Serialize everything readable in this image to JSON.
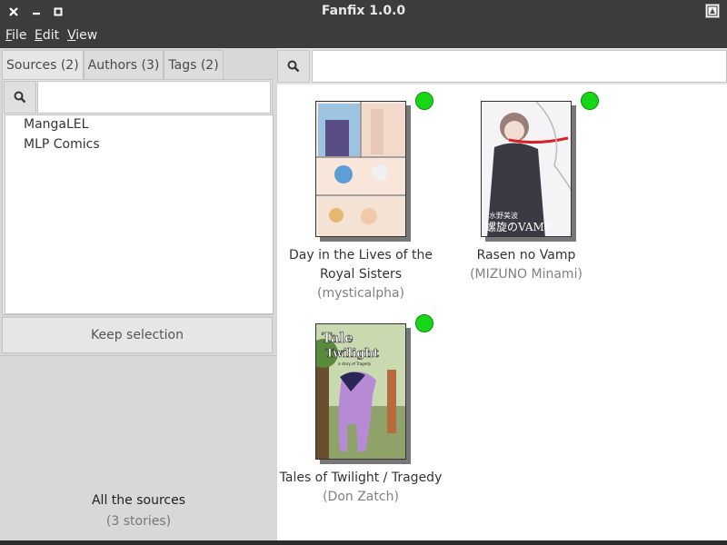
{
  "window": {
    "title": "Fanfix 1.0.0"
  },
  "menu": [
    {
      "mnemonic": "F",
      "rest": "ile"
    },
    {
      "mnemonic": "E",
      "rest": "dit"
    },
    {
      "mnemonic": "V",
      "rest": "iew"
    }
  ],
  "tabs": [
    {
      "label": "Sources (2)"
    },
    {
      "label": "Authors (3)"
    },
    {
      "label": "Tags (2)"
    }
  ],
  "sources": {
    "search_value": "",
    "items": [
      {
        "label": "MangaLEL"
      },
      {
        "label": "MLP Comics"
      }
    ],
    "keep_label": "Keep selection"
  },
  "summary": {
    "title": "All the sources",
    "count": "(3  stories)"
  },
  "library": {
    "search_value": "",
    "books": [
      {
        "title_lines": [
          "Day in the Lives of the",
          "Royal Sisters"
        ],
        "author": "(mysticalpha)",
        "cached": true
      },
      {
        "title_lines": [
          "Rasen no Vamp"
        ],
        "author": "(MIZUNO Minami)",
        "cached": true
      },
      {
        "title_lines": [
          "Tales of Twilight / Tragedy"
        ],
        "author": "(Don Zatch)",
        "cached": true
      }
    ],
    "cover_text": {
      "rasen_top": "水野美波",
      "rasen_main": "螺旋のVAMP",
      "twilight_line1": "Tale",
      "twilight_line2": "Twilight",
      "twilight_sub": "a story of Tragedy"
    }
  },
  "colors": {
    "titlebar": "#3c3c3c",
    "status_green": "#17d617",
    "panel": "#e6e6e6"
  },
  "icons": [
    "close-icon",
    "minimize-icon",
    "maximize-icon",
    "app-icon",
    "search-icon"
  ]
}
